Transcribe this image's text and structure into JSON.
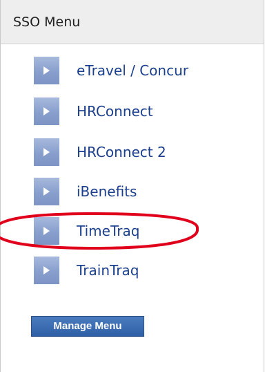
{
  "panel": {
    "title": "SSO Menu"
  },
  "menu": {
    "items": [
      {
        "label": "eTravel / Concur"
      },
      {
        "label": "HRConnect"
      },
      {
        "label": "HRConnect 2"
      },
      {
        "label": "iBenefits"
      },
      {
        "label": "TimeTraq",
        "highlighted": true
      },
      {
        "label": "TrainTraq"
      }
    ],
    "item_icon": "play-arrow-icon"
  },
  "manage_button": {
    "label": "Manage Menu"
  },
  "colors": {
    "link_text": "#1b3f8c",
    "icon_box": "#889fcd",
    "button": "#2f5fa6",
    "highlight_circle": "#e0001b"
  }
}
